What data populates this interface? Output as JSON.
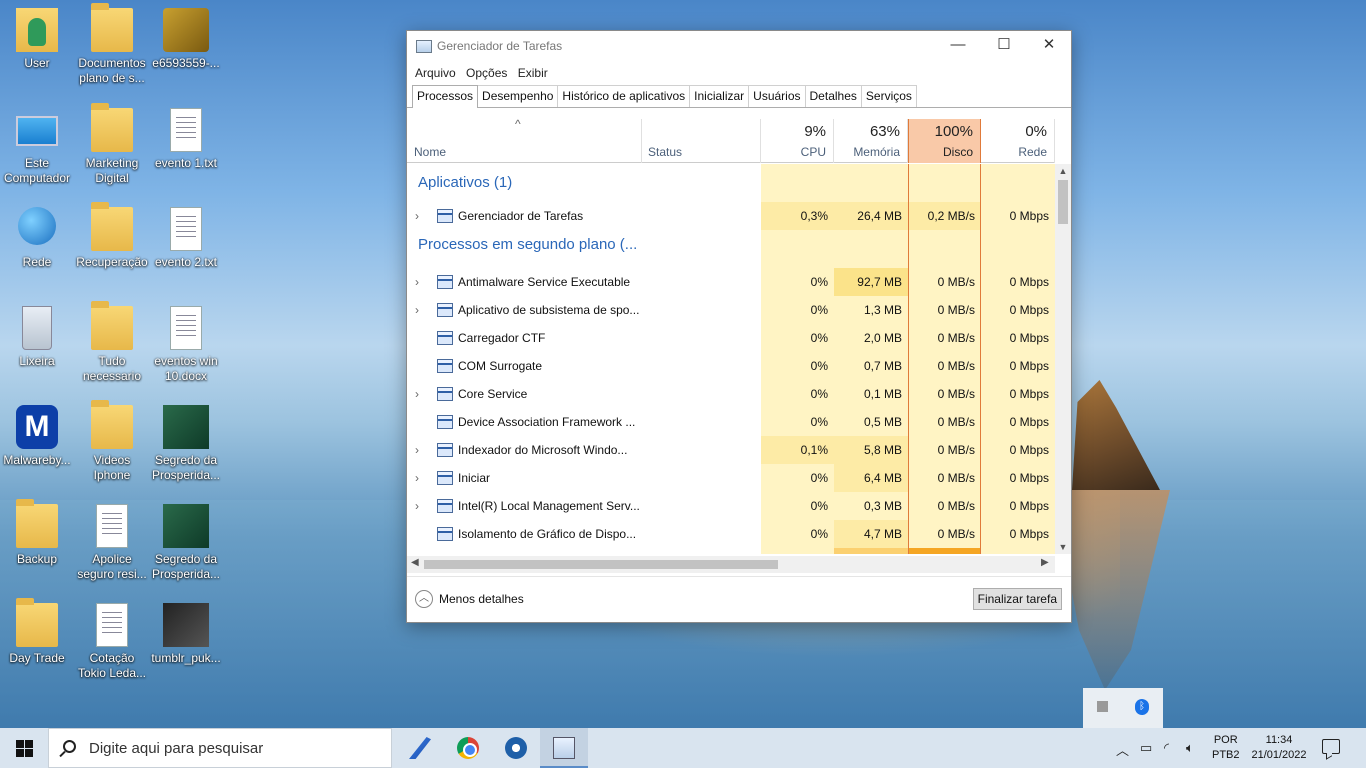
{
  "desktop": {
    "icons": [
      {
        "label": "User"
      },
      {
        "label": "Documentos plano de s..."
      },
      {
        "label": "e6593559-..."
      },
      {
        "label": "Este Computador"
      },
      {
        "label": "Marketing Digital"
      },
      {
        "label": "evento 1.txt"
      },
      {
        "label": "Rede"
      },
      {
        "label": "Recuperação"
      },
      {
        "label": "evento 2.txt"
      },
      {
        "label": "Lixeira"
      },
      {
        "label": "Tudo necessario"
      },
      {
        "label": "eventos win 10.docx"
      },
      {
        "label": "Malwareby..."
      },
      {
        "label": "Videos Iphone"
      },
      {
        "label": "Segredo da Prosperida..."
      },
      {
        "label": "Backup"
      },
      {
        "label": "Apolice seguro resi..."
      },
      {
        "label": "Segredo da Prosperida..."
      },
      {
        "label": "Day Trade"
      },
      {
        "label": "Cotação Tokio Leda..."
      },
      {
        "label": "tumblr_puk..."
      }
    ]
  },
  "window": {
    "title": "Gerenciador de Tarefas",
    "controls": {
      "minimize": "—",
      "maximize": "☐",
      "close": "✕"
    },
    "menu": [
      "Arquivo",
      "Opções",
      "Exibir"
    ],
    "tabs": [
      "Processos",
      "Desempenho",
      "Histórico de aplicativos",
      "Inicializar",
      "Usuários",
      "Detalhes",
      "Serviços"
    ],
    "active_tab": "Processos",
    "columns": {
      "name": "Nome",
      "status": "Status",
      "cpu": {
        "pct": "9%",
        "label": "CPU"
      },
      "memory": {
        "pct": "63%",
        "label": "Memória"
      },
      "disk": {
        "pct": "100%",
        "label": "Disco"
      },
      "network": {
        "pct": "0%",
        "label": "Rede"
      }
    },
    "groups": {
      "apps": "Aplicativos (1)",
      "background": "Processos em segundo plano (..."
    },
    "apps": [
      {
        "name": "Gerenciador de Tarefas",
        "cpu": "0,3%",
        "mem": "26,4 MB",
        "disk": "0,2 MB/s",
        "net": "0 Mbps",
        "expandable": true
      }
    ],
    "processes": [
      {
        "name": "Antimalware Service Executable",
        "cpu": "0%",
        "mem": "92,7 MB",
        "disk": "0 MB/s",
        "net": "0 Mbps",
        "expandable": true
      },
      {
        "name": "Aplicativo de subsistema de spo...",
        "cpu": "0%",
        "mem": "1,3 MB",
        "disk": "0 MB/s",
        "net": "0 Mbps",
        "expandable": true
      },
      {
        "name": "Carregador CTF",
        "cpu": "0%",
        "mem": "2,0 MB",
        "disk": "0 MB/s",
        "net": "0 Mbps",
        "expandable": false
      },
      {
        "name": "COM Surrogate",
        "cpu": "0%",
        "mem": "0,7 MB",
        "disk": "0 MB/s",
        "net": "0 Mbps",
        "expandable": false
      },
      {
        "name": "Core Service",
        "cpu": "0%",
        "mem": "0,1 MB",
        "disk": "0 MB/s",
        "net": "0 Mbps",
        "expandable": true
      },
      {
        "name": "Device Association Framework ...",
        "cpu": "0%",
        "mem": "0,5 MB",
        "disk": "0 MB/s",
        "net": "0 Mbps",
        "expandable": false
      },
      {
        "name": "Indexador do Microsoft Windo...",
        "cpu": "0,1%",
        "mem": "5,8 MB",
        "disk": "0 MB/s",
        "net": "0 Mbps",
        "expandable": true
      },
      {
        "name": "Iniciar",
        "cpu": "0%",
        "mem": "6,4 MB",
        "disk": "0 MB/s",
        "net": "0 Mbps",
        "expandable": true
      },
      {
        "name": "Intel(R) Local Management Serv...",
        "cpu": "0%",
        "mem": "0,3 MB",
        "disk": "0 MB/s",
        "net": "0 Mbps",
        "expandable": true
      },
      {
        "name": "Isolamento de Gráfico de Dispo...",
        "cpu": "0%",
        "mem": "4,7 MB",
        "disk": "0 MB/s",
        "net": "0 Mbps",
        "expandable": false
      }
    ],
    "footer": {
      "less_details": "Menos detalhes",
      "end_task": "Finalizar tarefa"
    }
  },
  "taskbar": {
    "search_placeholder": "Digite aqui para pesquisar",
    "lang_line1": "POR",
    "lang_line2": "PTB2",
    "time": "11:34",
    "date": "21/01/2022"
  }
}
